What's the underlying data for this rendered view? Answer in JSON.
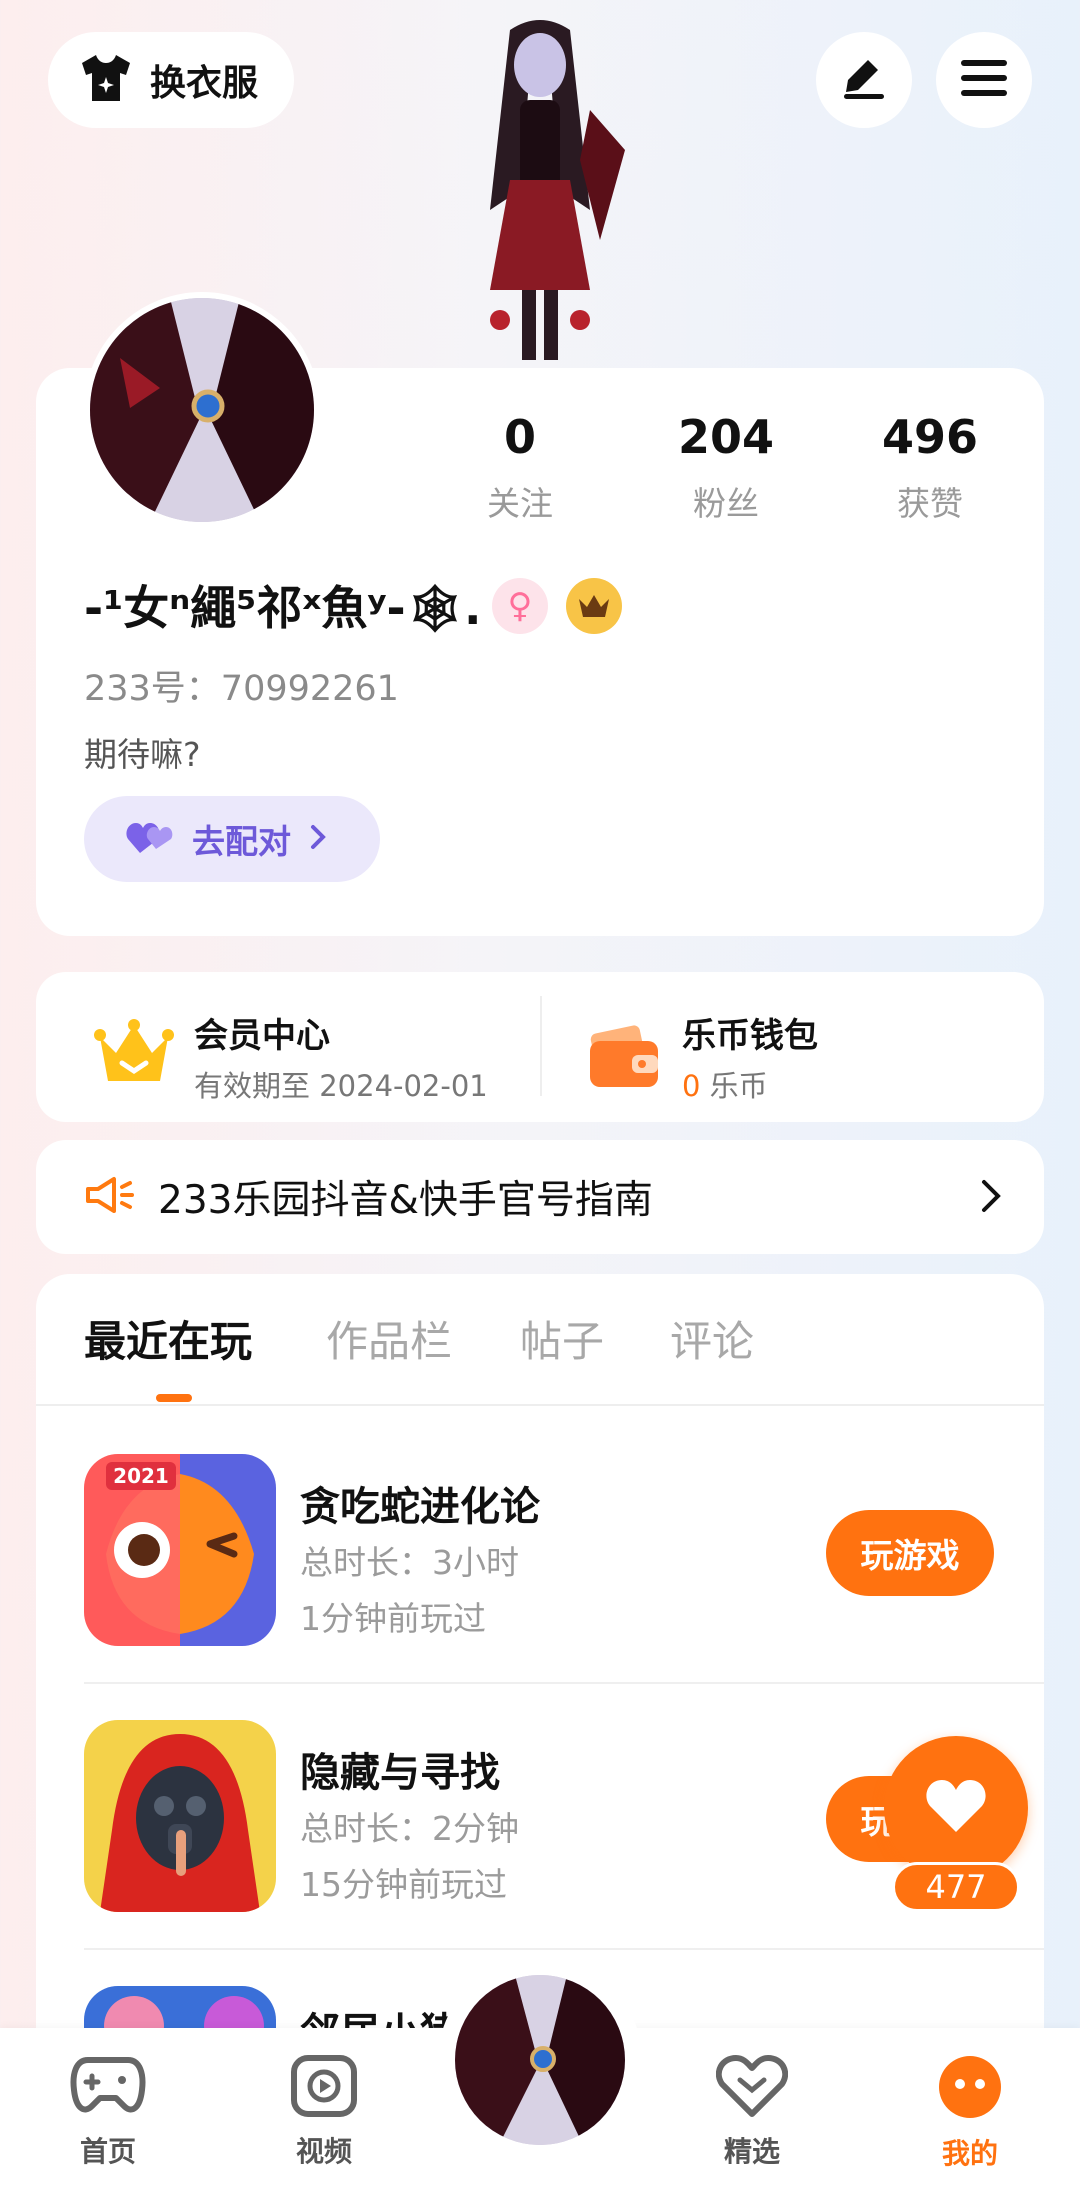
{
  "header": {
    "outfit_label": "换衣服",
    "edit_icon": "pencil-icon",
    "menu_icon": "hamburger-menu-icon"
  },
  "profile": {
    "stats": [
      {
        "value": "0",
        "label": "关注"
      },
      {
        "value": "204",
        "label": "粉丝"
      },
      {
        "value": "496",
        "label": "获赞"
      }
    ],
    "nickname": "-¹女ⁿ繩⁵祁ˣ魚ʸ-🕸.",
    "gender_symbol": "♀",
    "uid": "233号：70992261",
    "bio": "期待嘛?",
    "pair_button": "去配对"
  },
  "member": {
    "title": "会员中心",
    "subtitle": "有效期至 2024-02-01"
  },
  "wallet": {
    "title": "乐币钱包",
    "amount": "0",
    "unit": "乐币"
  },
  "notice": {
    "text": "233乐园抖音&快手官号指南"
  },
  "tabs": [
    {
      "label": "最近在玩"
    },
    {
      "label": "作品栏"
    },
    {
      "label": "帖子"
    },
    {
      "label": "评论"
    }
  ],
  "games": [
    {
      "name": "贪吃蛇进化论",
      "duration": "总时长：3小时",
      "last_played": "1分钟前玩过",
      "button": "玩游戏",
      "icon_badge": "2021"
    },
    {
      "name": "隐藏与寻找",
      "duration": "总时长：2分钟",
      "last_played": "15分钟前玩过",
      "button": "玩游戏"
    },
    {
      "name": "邻居小猪"
    }
  ],
  "like": {
    "count": "477"
  },
  "nav": [
    {
      "label": "首页"
    },
    {
      "label": "视频"
    },
    {
      "label": "精选"
    },
    {
      "label": "我的"
    }
  ],
  "colors": {
    "accent": "#ff7210",
    "pair_bg": "#ebe8fb",
    "pair_text": "#6d59d9"
  }
}
